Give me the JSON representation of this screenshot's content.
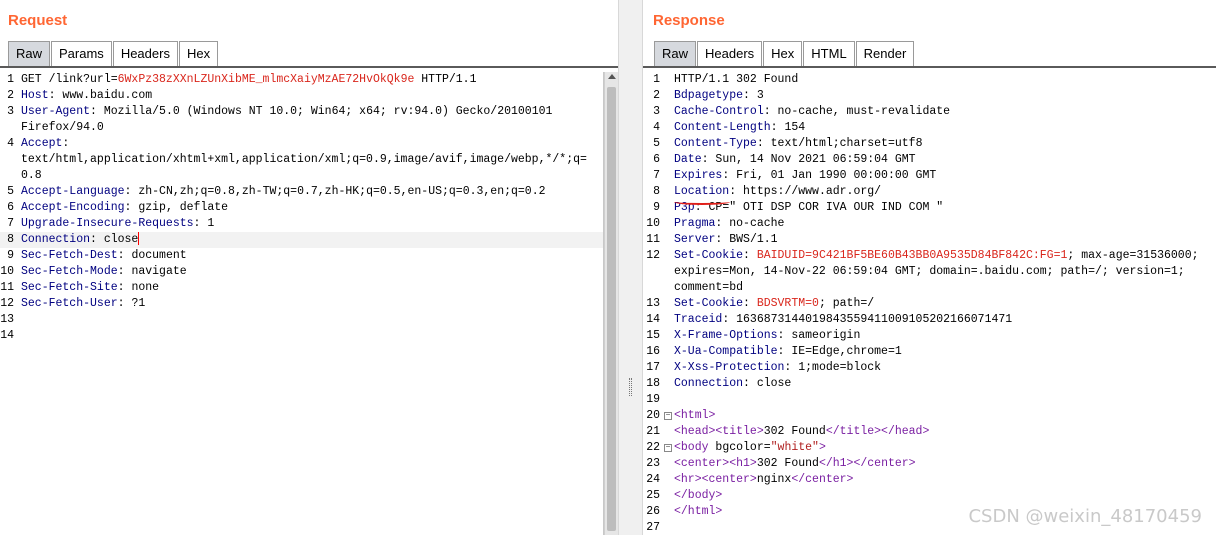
{
  "request": {
    "title": "Request",
    "tabs": [
      "Raw",
      "Params",
      "Headers",
      "Hex"
    ],
    "active_tab": "Raw",
    "lines": [
      {
        "n": "1",
        "parts": [
          [
            "t",
            "GET /link?url="
          ],
          [
            "c",
            "6WxPz38zXXnLZUnXibME_mlmcXaiyMzAE72HvOkQk9e"
          ],
          [
            "t",
            " HTTP/1.1"
          ]
        ]
      },
      {
        "n": "2",
        "parts": [
          [
            "h",
            "Host"
          ],
          [
            "s",
            ": "
          ],
          [
            "t",
            "www.baidu.com"
          ]
        ]
      },
      {
        "n": "3",
        "parts": [
          [
            "h",
            "User-Agent"
          ],
          [
            "s",
            ": "
          ],
          [
            "t",
            "Mozilla/5.0 (Windows NT 10.0; Win64; x64; rv:94.0) Gecko/20100101"
          ]
        ]
      },
      {
        "n": "",
        "parts": [
          [
            "t",
            "Firefox/94.0"
          ]
        ]
      },
      {
        "n": "4",
        "parts": [
          [
            "h",
            "Accept"
          ],
          [
            "s",
            ":"
          ]
        ]
      },
      {
        "n": "",
        "parts": [
          [
            "t",
            "text/html,application/xhtml+xml,application/xml;q=0.9,image/avif,image/webp,*/*;q="
          ]
        ]
      },
      {
        "n": "",
        "parts": [
          [
            "t",
            "0.8"
          ]
        ]
      },
      {
        "n": "5",
        "parts": [
          [
            "h",
            "Accept-Language"
          ],
          [
            "s",
            ": "
          ],
          [
            "t",
            "zh-CN,zh;q=0.8,zh-TW;q=0.7,zh-HK;q=0.5,en-US;q=0.3,en;q=0.2"
          ]
        ]
      },
      {
        "n": "6",
        "parts": [
          [
            "h",
            "Accept-Encoding"
          ],
          [
            "s",
            ": "
          ],
          [
            "t",
            "gzip, deflate"
          ]
        ]
      },
      {
        "n": "7",
        "parts": [
          [
            "h",
            "Upgrade-Insecure-Requests"
          ],
          [
            "s",
            ": "
          ],
          [
            "t",
            "1"
          ]
        ]
      },
      {
        "n": "8",
        "parts": [
          [
            "h",
            "Connection"
          ],
          [
            "s",
            ": "
          ],
          [
            "t",
            "close"
          ]
        ],
        "current": true
      },
      {
        "n": "9",
        "parts": [
          [
            "h",
            "Sec-Fetch-Dest"
          ],
          [
            "s",
            ": "
          ],
          [
            "t",
            "document"
          ]
        ]
      },
      {
        "n": "10",
        "parts": [
          [
            "h",
            "Sec-Fetch-Mode"
          ],
          [
            "s",
            ": "
          ],
          [
            "t",
            "navigate"
          ]
        ]
      },
      {
        "n": "11",
        "parts": [
          [
            "h",
            "Sec-Fetch-Site"
          ],
          [
            "s",
            ": "
          ],
          [
            "t",
            "none"
          ]
        ]
      },
      {
        "n": "12",
        "parts": [
          [
            "h",
            "Sec-Fetch-User"
          ],
          [
            "s",
            ": "
          ],
          [
            "t",
            "?1"
          ]
        ]
      },
      {
        "n": "13",
        "parts": []
      },
      {
        "n": "14",
        "parts": []
      }
    ]
  },
  "response": {
    "title": "Response",
    "tabs": [
      "Raw",
      "Headers",
      "Hex",
      "HTML",
      "Render"
    ],
    "active_tab": "Raw",
    "lines": [
      {
        "n": "1",
        "parts": [
          [
            "t",
            "HTTP/1.1 302 Found"
          ]
        ]
      },
      {
        "n": "2",
        "parts": [
          [
            "h",
            "Bdpagetype"
          ],
          [
            "s",
            ": "
          ],
          [
            "t",
            "3"
          ]
        ]
      },
      {
        "n": "3",
        "parts": [
          [
            "h",
            "Cache-Control"
          ],
          [
            "s",
            ": "
          ],
          [
            "t",
            "no-cache, must-revalidate"
          ]
        ]
      },
      {
        "n": "4",
        "parts": [
          [
            "h",
            "Content-Length"
          ],
          [
            "s",
            ": "
          ],
          [
            "t",
            "154"
          ]
        ]
      },
      {
        "n": "5",
        "parts": [
          [
            "h",
            "Content-Type"
          ],
          [
            "s",
            ": "
          ],
          [
            "t",
            "text/html;charset=utf8"
          ]
        ]
      },
      {
        "n": "6",
        "parts": [
          [
            "h",
            "Date"
          ],
          [
            "s",
            ": "
          ],
          [
            "t",
            "Sun, 14 Nov 2021 06:59:04 GMT"
          ]
        ]
      },
      {
        "n": "7",
        "parts": [
          [
            "h",
            "Expires"
          ],
          [
            "s",
            ": "
          ],
          [
            "t",
            "Fri, 01 Jan 1990 00:00:00 GMT"
          ]
        ]
      },
      {
        "n": "8",
        "parts": [
          [
            "h",
            "Location"
          ],
          [
            "s",
            ": "
          ],
          [
            "t",
            "https://www.adr.org/"
          ]
        ]
      },
      {
        "n": "9",
        "parts": [
          [
            "h",
            "P3p"
          ],
          [
            "s",
            ": "
          ],
          [
            "t",
            "CP=\" OTI DSP COR IVA OUR IND COM \""
          ]
        ]
      },
      {
        "n": "10",
        "parts": [
          [
            "h",
            "Pragma"
          ],
          [
            "s",
            ": "
          ],
          [
            "t",
            "no-cache"
          ]
        ]
      },
      {
        "n": "11",
        "parts": [
          [
            "h",
            "Server"
          ],
          [
            "s",
            ": "
          ],
          [
            "t",
            "BWS/1.1"
          ]
        ]
      },
      {
        "n": "12",
        "parts": [
          [
            "h",
            "Set-Cookie"
          ],
          [
            "s",
            ": "
          ],
          [
            "c",
            "BAIDUID=9C421BF5BE60B43BB0A9535D84BF842C:FG=1"
          ],
          [
            "t",
            "; max-age=31536000;"
          ]
        ]
      },
      {
        "n": "",
        "parts": [
          [
            "t",
            "expires=Mon, 14-Nov-22 06:59:04 GMT; domain=.baidu.com; path=/; version=1;"
          ]
        ]
      },
      {
        "n": "",
        "parts": [
          [
            "t",
            "comment=bd"
          ]
        ]
      },
      {
        "n": "13",
        "parts": [
          [
            "h",
            "Set-Cookie"
          ],
          [
            "s",
            ": "
          ],
          [
            "c",
            "BDSVRTM=0"
          ],
          [
            "t",
            "; path=/"
          ]
        ]
      },
      {
        "n": "14",
        "parts": [
          [
            "h",
            "Traceid"
          ],
          [
            "s",
            ": "
          ],
          [
            "t",
            "1636873144019843559411009105202166071471"
          ]
        ]
      },
      {
        "n": "15",
        "parts": [
          [
            "h",
            "X-Frame-Options"
          ],
          [
            "s",
            ": "
          ],
          [
            "t",
            "sameorigin"
          ]
        ]
      },
      {
        "n": "16",
        "parts": [
          [
            "h",
            "X-Ua-Compatible"
          ],
          [
            "s",
            ": "
          ],
          [
            "t",
            "IE=Edge,chrome=1"
          ]
        ]
      },
      {
        "n": "17",
        "parts": [
          [
            "h",
            "X-Xss-Protection"
          ],
          [
            "s",
            ": "
          ],
          [
            "t",
            "1;mode=block"
          ]
        ]
      },
      {
        "n": "18",
        "parts": [
          [
            "h",
            "Connection"
          ],
          [
            "s",
            ": "
          ],
          [
            "t",
            "close"
          ]
        ]
      },
      {
        "n": "19",
        "parts": []
      },
      {
        "n": "20",
        "fold": true,
        "parts": [
          [
            "g",
            "<html>"
          ]
        ]
      },
      {
        "n": "21",
        "parts": [
          [
            "g",
            "<head><title>"
          ],
          [
            "t",
            "302 Found"
          ],
          [
            "g",
            "</title></head>"
          ]
        ]
      },
      {
        "n": "22",
        "fold": true,
        "parts": [
          [
            "g",
            "<body "
          ],
          [
            "t",
            "bgcolor="
          ],
          [
            "r",
            "\"white\""
          ],
          [
            "g",
            ">"
          ]
        ]
      },
      {
        "n": "23",
        "parts": [
          [
            "g",
            "<center><h1>"
          ],
          [
            "t",
            "302 Found"
          ],
          [
            "g",
            "</h1></center>"
          ]
        ]
      },
      {
        "n": "24",
        "parts": [
          [
            "g",
            "<hr><center>"
          ],
          [
            "t",
            "nginx"
          ],
          [
            "g",
            "</center>"
          ]
        ]
      },
      {
        "n": "25",
        "parts": [
          [
            "g",
            "</body>"
          ]
        ]
      },
      {
        "n": "26",
        "parts": [
          [
            "g",
            "</html>"
          ]
        ]
      },
      {
        "n": "27",
        "parts": []
      }
    ]
  },
  "watermark": "CSDN @weixin_48170459",
  "colors": {
    "title": "#ff6633",
    "header_name": "#000080",
    "cookie_value": "#d9261c",
    "tag": "#7a1fa2"
  }
}
